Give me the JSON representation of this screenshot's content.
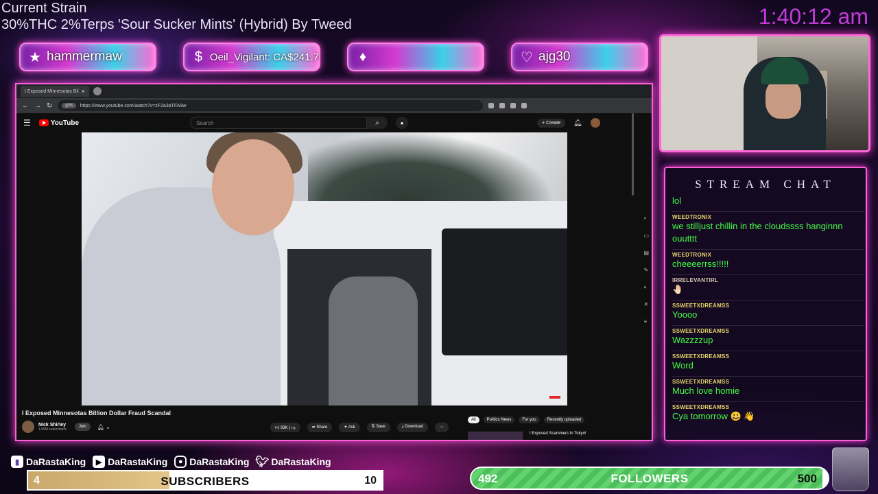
{
  "overlay": {
    "strain_title": "Current Strain",
    "strain_line": "30%THC 2%Terps 'Sour Sucker Mints' (Hybrid) By  Tweed",
    "clock": "1:40:12 am"
  },
  "banners": [
    {
      "icon": "star-icon",
      "glyph": "★",
      "text": "hammermaw"
    },
    {
      "icon": "dollar-icon",
      "glyph": "$",
      "text": "Oeil_Vigilant: CA$241.78"
    },
    {
      "icon": "diamond-icon",
      "glyph": "♦",
      "text": ""
    },
    {
      "icon": "heart-icon",
      "glyph": "♡",
      "text": "ajg30"
    }
  ],
  "browser": {
    "tab_title": "I Exposed Minnesotas Bil",
    "url_pill": "g/%",
    "url": "https://www.youtube.com/watch?v=zF2a3aTFA9w"
  },
  "youtube": {
    "logo": "YouTube",
    "search_placeholder": "Search",
    "create_label": "+ Create",
    "video_title": "I Exposed Minnesotas Billion Dollar Fraud Scandal",
    "channel_name": "Nick Shirley",
    "channel_subs": "1.56M subscribers",
    "join_label": "Join",
    "actions": {
      "like": "93K",
      "share": "Share",
      "ask": "Ask",
      "save": "Save",
      "download": "Download"
    },
    "chips": [
      "All",
      "Politics News",
      "For you",
      "Recently uploaded"
    ],
    "recommended_title": "I Exposed Scammers In Tokyo!"
  },
  "chat": {
    "title": "STREAM CHAT",
    "messages": [
      {
        "user": "",
        "text": "lol"
      },
      {
        "user": "WEEDTRONIX",
        "text": "we stilljust chillin in the cloudssss hanginnn ouutttt"
      },
      {
        "user": "WEEDTRONIX",
        "text": "cheeeerrss!!!!!"
      },
      {
        "user": "IRRELEVANTIRL",
        "text": "🤚🏻"
      },
      {
        "user": "SSWEETXDREAMSS",
        "text": "Yoooo"
      },
      {
        "user": "SSWEETXDREAMSS",
        "text": "Wazzzzup"
      },
      {
        "user": "SSWEETXDREAMSS",
        "text": "Word"
      },
      {
        "user": "SSWEETXDREAMSS",
        "text": "Much love homie"
      },
      {
        "user": "SSWEETXDREAMSS",
        "text": "Cya tomorrow 😃 👋"
      }
    ]
  },
  "socials": [
    {
      "icon": "twitch-icon",
      "handle": "DaRastaKing"
    },
    {
      "icon": "youtube-icon",
      "handle": "DaRastaKing"
    },
    {
      "icon": "instagram-icon",
      "handle": "DaRastaKing"
    },
    {
      "icon": "twitter-icon",
      "handle": "DaRastaKing"
    }
  ],
  "goals": {
    "subscribers": {
      "label": "SUBSCRIBERS",
      "current": "4",
      "target": "10",
      "progress": 0.4
    },
    "followers": {
      "label": "FOLLOWERS",
      "current": "492",
      "target": "500",
      "progress": 0.984
    }
  },
  "colors": {
    "accent_pink": "#ff5fd9",
    "clock_purple": "#c23bd8",
    "chat_text_green": "#44ff44",
    "chat_user_gold": "#e6d56a",
    "follower_green": "#4cbf5c",
    "sub_gold": "#c9a86a"
  }
}
